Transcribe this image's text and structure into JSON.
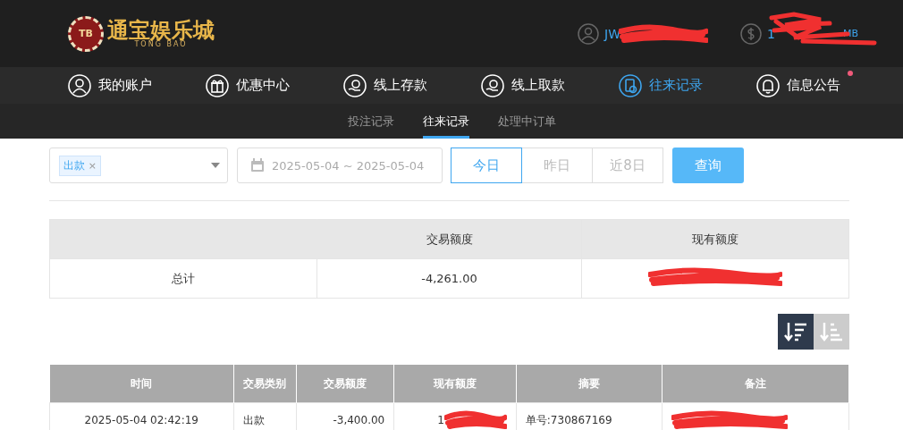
{
  "logo": {
    "badge": "TB",
    "name": "通宝娱乐城",
    "subtitle": "TONG BAO"
  },
  "user": {
    "username": "JW",
    "balance_prefix": "1",
    "balance_suffix": "MB"
  },
  "nav": [
    {
      "label": "我的账户",
      "kind": "user",
      "selected": false,
      "dot": false
    },
    {
      "label": "优惠中心",
      "kind": "gift",
      "selected": false,
      "dot": false
    },
    {
      "label": "线上存款",
      "kind": "deposit",
      "selected": false,
      "dot": false
    },
    {
      "label": "线上取款",
      "kind": "withdraw",
      "selected": false,
      "dot": false
    },
    {
      "label": "往来记录",
      "kind": "record",
      "selected": true,
      "dot": false
    },
    {
      "label": "信息公告",
      "kind": "bell",
      "selected": false,
      "dot": true
    }
  ],
  "subtabs": [
    {
      "label": "投注记录",
      "selected": false
    },
    {
      "label": "往来记录",
      "selected": true
    },
    {
      "label": "处理中订单",
      "selected": false
    }
  ],
  "filter": {
    "tag": "出款",
    "tag_close": "×",
    "date_range": "2025-05-04 ~ 2025-05-04",
    "quick": [
      {
        "label": "今日",
        "selected": true
      },
      {
        "label": "昨日",
        "selected": false
      },
      {
        "label": "近8日",
        "selected": false
      }
    ],
    "search_button": "查询"
  },
  "summary": {
    "columns": [
      "",
      "交易额度",
      "现有额度"
    ],
    "label": "总计",
    "amount": "-4,261.00"
  },
  "sort": [
    {
      "kind": "desc",
      "selected": true
    },
    {
      "kind": "asc",
      "selected": false
    }
  ],
  "table": {
    "columns": [
      "时间",
      "交易类别",
      "交易额度",
      "现有额度",
      "摘要",
      "备注"
    ],
    "rows": [
      {
        "time": "2025-05-04 02:42:19",
        "type": "出款",
        "amount": "-3,400.00",
        "balance": "1",
        "summary": "单号:730867169"
      }
    ]
  }
}
